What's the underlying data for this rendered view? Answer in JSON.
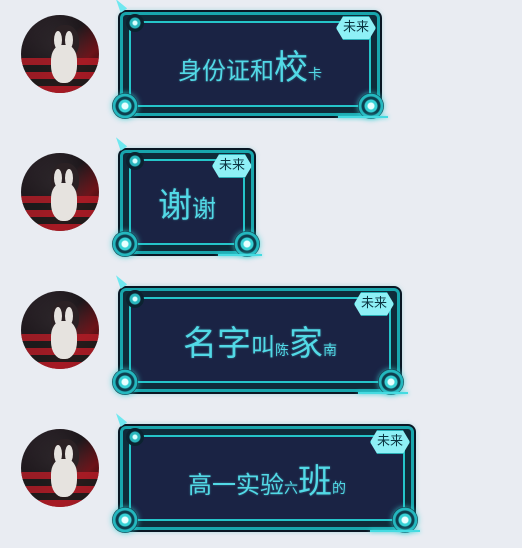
{
  "messages": [
    {
      "badge": "未来",
      "parts": [
        {
          "text": "身份证和",
          "size": "mid"
        },
        {
          "text": "校",
          "size": "big"
        },
        {
          "text": "卡",
          "size": "sml"
        }
      ]
    },
    {
      "badge": "未来",
      "parts": [
        {
          "text": "谢",
          "size": "big"
        },
        {
          "text": "谢",
          "size": "mid"
        }
      ]
    },
    {
      "badge": "未来",
      "parts": [
        {
          "text": "名字",
          "size": "big"
        },
        {
          "text": "叫",
          "size": "mid"
        },
        {
          "text": "陈",
          "size": "sml"
        },
        {
          "text": "家",
          "size": "big"
        },
        {
          "text": "南",
          "size": "sml"
        }
      ]
    },
    {
      "badge": "未来",
      "parts": [
        {
          "text": "高一实验",
          "size": "mid"
        },
        {
          "text": "六",
          "size": "sml"
        },
        {
          "text": "班",
          "size": "big"
        },
        {
          "text": "的",
          "size": "sml"
        }
      ]
    }
  ],
  "icons": {
    "avatar": "user-avatar-photo",
    "orb": "glowing-orb-ornament",
    "badge": "hexagon-badge"
  }
}
